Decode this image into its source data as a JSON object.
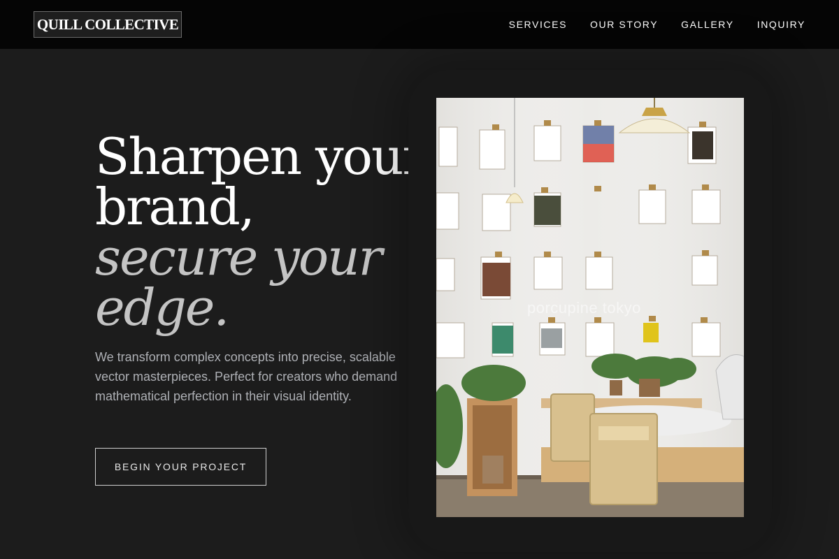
{
  "header": {
    "logo": "QUILL COLLECTIVE",
    "nav": [
      "SERVICES",
      "OUR STORY",
      "GALLERY",
      "INQUIRY"
    ]
  },
  "hero": {
    "title_line1": "Sharpen your",
    "title_line2": "brand,",
    "title_accent1": "secure your",
    "title_accent2": "edge.",
    "description": "We transform complex concepts into precise, scalable vector masterpieces. Perfect for creators who demand mathematical perfection in their visual identity.",
    "cta": "BEGIN YOUR PROJECT"
  },
  "image": {
    "watermark": "porcupine tokyo"
  },
  "colors": {
    "page_bg": "#1c1c1c",
    "header_bg": "#050505",
    "accent_text": "#c4c4c4",
    "body_text": "#aeb0b5"
  }
}
